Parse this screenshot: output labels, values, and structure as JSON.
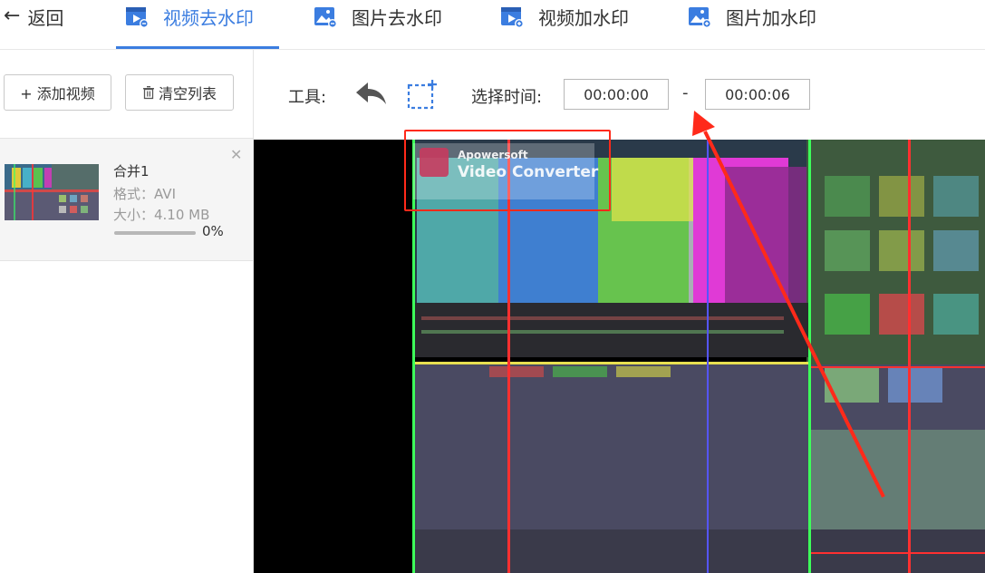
{
  "nav": {
    "back_label": "返回",
    "tabs": [
      {
        "label": "视频去水印",
        "icon": "video-watermark-remove-icon",
        "active": true
      },
      {
        "label": "图片去水印",
        "icon": "image-watermark-remove-icon",
        "active": false
      },
      {
        "label": "视频加水印",
        "icon": "video-watermark-add-icon",
        "active": false
      },
      {
        "label": "图片加水印",
        "icon": "image-watermark-add-icon",
        "active": false
      }
    ]
  },
  "left_panel": {
    "add_video_label": "+ 添加视频",
    "clear_list_label": "清空列表",
    "items": [
      {
        "name": "合并1",
        "format": "格式：AVI",
        "size": "大小：4.10 MB",
        "progress": "0%",
        "progress_value": 0
      }
    ]
  },
  "toolbar": {
    "tools_label": "工具:",
    "time_label": "选择时间:",
    "start_time": "00:00:00",
    "end_time": "00:00:06",
    "separator": "-"
  },
  "video_watermark": {
    "brand": "Apowersoft",
    "product": "Video Converter"
  },
  "colors": {
    "accent": "#3b7de0",
    "highlight_red": "#ff2a1a",
    "video_bg": "#000000"
  }
}
